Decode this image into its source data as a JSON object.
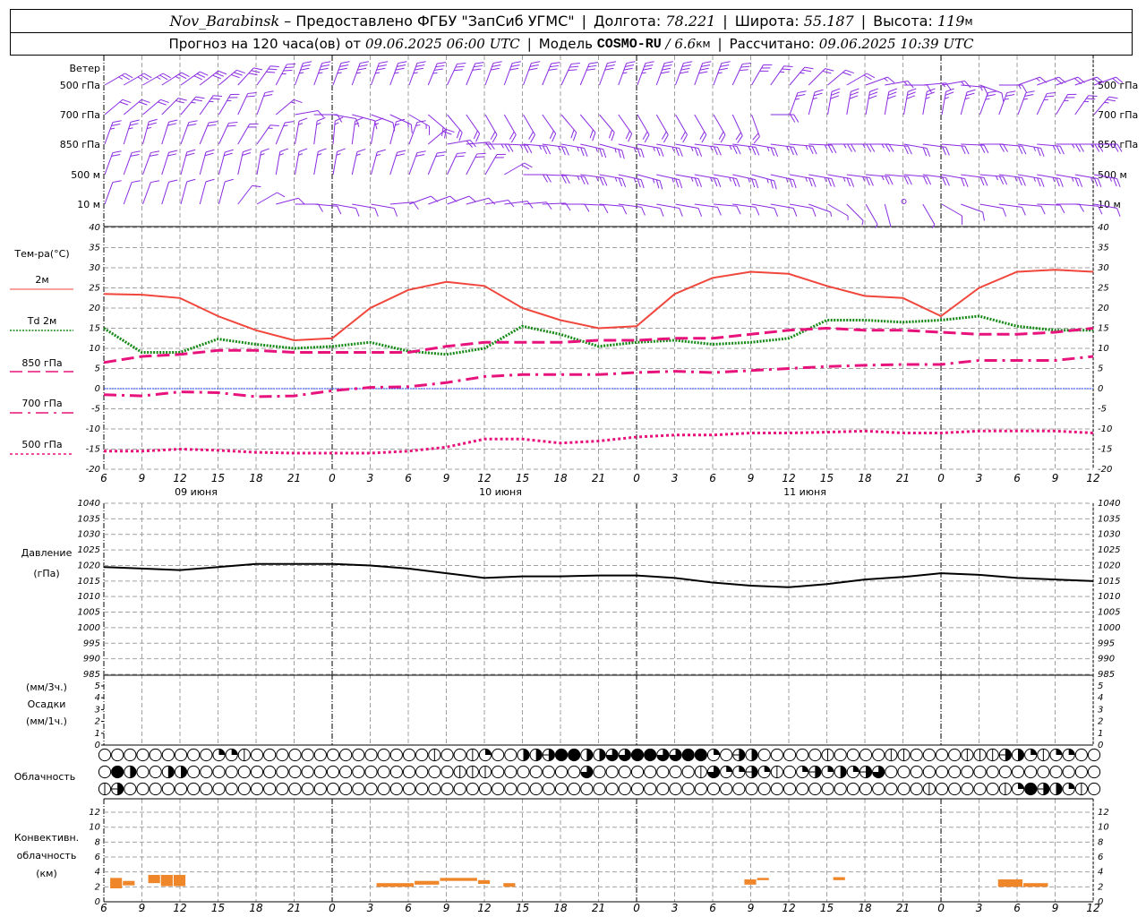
{
  "header": {
    "station": "Nov_Barabinsk",
    "dash": "–",
    "provider": "Предоставлено ФГБУ \"ЗапСиб УГМС\"",
    "lon_label": "Долгота:",
    "lon": "78.221",
    "lat_label": "Широта:",
    "lat": "55.187",
    "alt_label": "Высота:",
    "alt": "119",
    "alt_unit": "м",
    "forecast_label": "Прогноз на 120 часа(ов) от",
    "forecast_start": "09.06.2025 06:00 UTC",
    "model_label": "Модель",
    "model": "COSMO-RU",
    "resolution": "/ 6.6",
    "resolution_unit": "км",
    "computed_label": "Рассчитано:",
    "computed": "09.06.2025 10:39 UTC"
  },
  "labels": {
    "wind": "Ветер",
    "wind_levels": [
      "500 гПа",
      "700 гПа",
      "850 гПа",
      "500 м",
      "10 м"
    ],
    "temp_title": "Тем-ра(°C)",
    "temp_legend": [
      "2м",
      "Td  2м",
      "850 гПа",
      "700 гПа",
      "500 гПа"
    ],
    "pressure_title": "Давление",
    "pressure_unit": "(гПа)",
    "precip_unit3": "(мм/3ч.)",
    "precip_title": "Осадки",
    "precip_unit1": "(мм/1ч.)",
    "cloud_title": "Облачность",
    "conv_title1": "Конвективн.",
    "conv_title2": "облачность",
    "conv_unit": "(км)",
    "dates": [
      "09 июня",
      "10 июня",
      "11 июня"
    ]
  },
  "colors": {
    "t2m": "#f0463c",
    "td2m": "#168a16",
    "t850": "#e8127c",
    "t700": "#e8127c",
    "t500": "#e8127c",
    "zero_line": "#2040ff",
    "wind": "#8a2be2",
    "pressure": "#000000",
    "convective": "#f0862a",
    "grid": "#a0a0a0"
  },
  "chart_data": [
    {
      "type": "line",
      "name": "wind",
      "x_ticks": [
        "6",
        "9",
        "12",
        "15",
        "18",
        "21",
        "0",
        "3",
        "6",
        "9",
        "12",
        "15",
        "18",
        "21",
        "0",
        "3",
        "6",
        "9",
        "12",
        "15",
        "18",
        "21",
        "0",
        "3",
        "6",
        "9",
        "12"
      ],
      "levels": [
        {
          "label": "500 гПа",
          "dir": [
            240,
            240,
            235,
            230,
            215,
            200,
            200,
            200,
            200,
            205,
            200,
            200,
            205,
            200,
            200,
            200,
            200,
            210,
            220,
            230,
            250,
            270,
            260,
            290,
            250,
            250,
            250
          ],
          "speed": [
            12,
            12,
            14,
            15,
            16,
            18,
            18,
            18,
            18,
            16,
            16,
            16,
            14,
            16,
            18,
            20,
            18,
            14,
            12,
            10,
            8,
            6,
            8,
            6,
            8,
            10,
            10
          ]
        },
        {
          "label": "700 гПа",
          "dir": [
            230,
            230,
            220,
            210,
            200,
            260,
            280,
            290,
            300,
            320,
            330,
            330,
            320,
            320,
            330,
            330,
            330,
            340,
            200,
            190,
            190,
            190,
            190,
            200,
            200,
            210,
            220
          ],
          "speed": [
            10,
            10,
            12,
            12,
            10,
            6,
            6,
            6,
            8,
            10,
            10,
            10,
            10,
            10,
            10,
            10,
            10,
            10,
            12,
            14,
            14,
            14,
            12,
            12,
            12,
            12,
            12
          ]
        },
        {
          "label": "850 гПа",
          "dir": [
            200,
            195,
            200,
            205,
            215,
            190,
            185,
            190,
            200,
            260,
            270,
            275,
            280,
            285,
            280,
            280,
            275,
            280,
            275,
            270,
            270,
            280,
            275,
            270,
            280,
            270,
            270
          ],
          "speed": [
            12,
            12,
            10,
            10,
            8,
            8,
            8,
            8,
            8,
            10,
            12,
            12,
            12,
            12,
            12,
            12,
            12,
            12,
            12,
            12,
            12,
            10,
            10,
            10,
            12,
            12,
            12
          ]
        },
        {
          "label": "500 м",
          "dir": [
            200,
            200,
            195,
            195,
            190,
            190,
            190,
            195,
            200,
            205,
            210,
            270,
            275,
            280,
            285,
            280,
            280,
            285,
            280,
            280,
            275,
            275,
            280,
            275,
            280,
            280,
            280
          ],
          "speed": [
            10,
            10,
            10,
            10,
            8,
            8,
            8,
            8,
            10,
            10,
            10,
            10,
            12,
            12,
            12,
            12,
            12,
            12,
            12,
            12,
            12,
            10,
            10,
            12,
            12,
            12,
            12
          ]
        },
        {
          "label": "10 м",
          "dir": [
            200,
            200,
            195,
            195,
            240,
            270,
            280,
            280,
            250,
            250,
            260,
            265,
            270,
            275,
            280,
            280,
            275,
            280,
            280,
            300,
            330,
            0,
            300,
            280,
            275,
            270,
            280
          ],
          "speed": [
            6,
            6,
            6,
            6,
            6,
            4,
            4,
            4,
            6,
            6,
            6,
            6,
            6,
            6,
            6,
            6,
            6,
            4,
            4,
            2,
            2,
            0,
            4,
            6,
            6,
            6,
            6
          ]
        }
      ]
    },
    {
      "type": "line",
      "name": "temperature",
      "x_ticks": [
        "6",
        "9",
        "12",
        "15",
        "18",
        "21",
        "0",
        "3",
        "6",
        "9",
        "12",
        "15",
        "18",
        "21",
        "0",
        "3",
        "6",
        "9",
        "12",
        "15",
        "18",
        "21",
        "0",
        "3",
        "6",
        "9",
        "12"
      ],
      "ylim": [
        -20,
        40
      ],
      "y_ticks": [
        40,
        35,
        30,
        25,
        20,
        15,
        10,
        5,
        0,
        -5,
        -10,
        -15,
        -20
      ],
      "grid": true,
      "series": [
        {
          "name": "2м",
          "values": [
            23.5,
            23.3,
            22.5,
            18,
            14.5,
            12,
            12.5,
            20,
            24.5,
            26.5,
            25.5,
            20,
            17,
            15,
            15.5,
            23.5,
            27.5,
            29,
            28.5,
            25.5,
            23,
            22.5,
            18,
            25,
            29,
            29.5,
            29
          ]
        },
        {
          "name": "Td  2м",
          "values": [
            15,
            9,
            9,
            12.3,
            11,
            10,
            10.5,
            11.5,
            9.3,
            8.5,
            10,
            15.5,
            13.5,
            10.5,
            11.5,
            12,
            11,
            11.5,
            12.5,
            17,
            17,
            16.5,
            17,
            18,
            15.5,
            14.5,
            14.5
          ]
        },
        {
          "name": "850 гПа",
          "values": [
            6.5,
            8,
            8.5,
            9.5,
            9.5,
            9,
            9,
            9,
            9,
            10.5,
            11.5,
            11.5,
            11.5,
            12,
            12,
            12.5,
            12.5,
            13.5,
            14.5,
            15,
            14.5,
            14.5,
            14,
            13.5,
            13.5,
            14,
            15
          ]
        },
        {
          "name": "700 гПа",
          "values": [
            -1.5,
            -1.8,
            -0.8,
            -1,
            -2,
            -1.8,
            -0.5,
            0.3,
            0.5,
            1.5,
            3,
            3.5,
            3.5,
            3.5,
            4,
            4.3,
            4,
            4.5,
            5,
            5.5,
            5.8,
            6,
            6,
            7,
            7,
            7,
            8
          ]
        },
        {
          "name": "500 гПа",
          "values": [
            -15.5,
            -15.5,
            -15,
            -15.3,
            -15.8,
            -16,
            -16,
            -16,
            -15.5,
            -14.5,
            -12.5,
            -12.5,
            -13.5,
            -13,
            -12,
            -11.5,
            -11.5,
            -11,
            -11,
            -10.8,
            -10.5,
            -11,
            -11,
            -10.5,
            -10.5,
            -10.5,
            -11
          ]
        }
      ]
    },
    {
      "type": "line",
      "name": "pressure",
      "ylim": [
        985,
        1040
      ],
      "y_ticks": [
        1040,
        1035,
        1030,
        1025,
        1020,
        1015,
        1010,
        1005,
        1000,
        995,
        990,
        985
      ],
      "grid": true,
      "values": [
        1019.5,
        1019,
        1018.5,
        1019.5,
        1020.5,
        1020.5,
        1020.5,
        1020,
        1019,
        1017.5,
        1016,
        1016.5,
        1016.5,
        1016.8,
        1016.8,
        1016,
        1014.5,
        1013.5,
        1013,
        1014,
        1015.5,
        1016.3,
        1017.5,
        1017,
        1016,
        1015.5,
        1015
      ]
    },
    {
      "type": "bar",
      "name": "precipitation",
      "ylim": [
        0,
        5
      ],
      "y_ticks": [
        5,
        4,
        3,
        2,
        1,
        0
      ],
      "values": []
    },
    {
      "type": "table",
      "name": "cloudiness",
      "rows": [
        [
          "0",
          "0",
          "0",
          "0",
          "0",
          "0",
          "0",
          "0",
          "0",
          "q",
          "q",
          "v",
          "0",
          "0",
          "0",
          "0",
          "0",
          "0",
          "0",
          "0",
          "0",
          "0",
          "0",
          "0",
          "0",
          "0",
          "v",
          "0",
          "0",
          "v",
          "q",
          "0",
          "0",
          "h",
          "h",
          "hl",
          "f",
          "f",
          "h",
          "h",
          "t",
          "t",
          "f",
          "f",
          "t",
          "t",
          "f",
          "f",
          "q",
          "0",
          "hl",
          "h",
          "0",
          "0",
          "0",
          "0",
          "0",
          "v",
          "0",
          "0",
          "0",
          "0",
          "v",
          "v",
          "0",
          "0",
          "0",
          "0",
          "v",
          "v",
          "v",
          "hl",
          "h",
          "q",
          "v",
          "q",
          "q",
          "0",
          "0"
        ],
        [
          "0",
          "f",
          "h",
          "0",
          "0",
          "h",
          "h",
          "0",
          "0",
          "0",
          "0",
          "0",
          "0",
          "0",
          "0",
          "0",
          "0",
          "0",
          "0",
          "0",
          "0",
          "0",
          "0",
          "0",
          "0",
          "0",
          "0",
          "0",
          "v",
          "v",
          "v",
          "0",
          "0",
          "0",
          "0",
          "0",
          "0",
          "0",
          "t",
          "0",
          "0",
          "0",
          "0",
          "0",
          "0",
          "0",
          "0",
          "v",
          "t",
          "q",
          "q",
          "hl",
          "q",
          "v",
          "0",
          "q",
          "hl",
          "q",
          "h",
          "q",
          "hl",
          "t",
          "0",
          "0",
          "0",
          "0",
          "0",
          "0",
          "0",
          "0",
          "0",
          "0",
          "0",
          "0",
          "0",
          "0",
          "0",
          "0",
          "0"
        ],
        [
          "v",
          "hl",
          "0",
          "0",
          "0",
          "0",
          "0",
          "0",
          "0",
          "0",
          "0",
          "0",
          "0",
          "0",
          "0",
          "0",
          "0",
          "0",
          "0",
          "0",
          "0",
          "0",
          "0",
          "0",
          "0",
          "0",
          "0",
          "0",
          "0",
          "0",
          "0",
          "0",
          "0",
          "0",
          "0",
          "0",
          "0",
          "0",
          "0",
          "0",
          "0",
          "0",
          "0",
          "0",
          "0",
          "0",
          "0",
          "0",
          "0",
          "0",
          "0",
          "0",
          "0",
          "0",
          "0",
          "0",
          "0",
          "0",
          "0",
          "0",
          "0",
          "0",
          "0",
          "0",
          "0",
          "v",
          "0",
          "0",
          "0",
          "0",
          "0",
          "v",
          "q",
          "f",
          "hl",
          "h",
          "q",
          "v",
          "0"
        ]
      ]
    },
    {
      "type": "bar",
      "name": "convective",
      "ylim": [
        0,
        14
      ],
      "y_ticks": [
        12,
        10,
        8,
        6,
        4,
        2,
        0
      ],
      "x_ticks": [
        "6",
        "9",
        "12",
        "15",
        "18",
        "21",
        "0",
        "3",
        "6",
        "9",
        "12",
        "15",
        "18",
        "21",
        "0",
        "3",
        "6",
        "9",
        "12",
        "15",
        "18",
        "21",
        "0",
        "3",
        "6",
        "9",
        "12"
      ],
      "bars": [
        {
          "date": "09.06",
          "from": "06:30",
          "to": "07:30",
          "base": 1.8,
          "top": 3.2
        },
        {
          "date": "09.06",
          "from": "07:30",
          "to": "08:30",
          "base": 2.2,
          "top": 2.8
        },
        {
          "date": "09.06",
          "from": "09:30",
          "to": "10:30",
          "base": 2.5,
          "top": 3.6
        },
        {
          "date": "09.06",
          "from": "10:30",
          "to": "11:30",
          "base": 2.1,
          "top": 3.6
        },
        {
          "date": "09.06",
          "from": "11:30",
          "to": "12:30",
          "base": 2.1,
          "top": 3.6
        },
        {
          "date": "10.06",
          "from": "03:30",
          "to": "06:30",
          "base": 2.0,
          "top": 2.5
        },
        {
          "date": "10.06",
          "from": "06:30",
          "to": "08:30",
          "base": 2.3,
          "top": 2.8
        },
        {
          "date": "10.06",
          "from": "08:30",
          "to": "11:30",
          "base": 2.8,
          "top": 3.2
        },
        {
          "date": "10.06",
          "from": "11:30",
          "to": "12:30",
          "base": 2.4,
          "top": 2.9
        },
        {
          "date": "10.06",
          "from": "13:30",
          "to": "14:30",
          "base": 2.0,
          "top": 2.5
        },
        {
          "date": "11.06",
          "from": "08:30",
          "to": "09:30",
          "base": 2.3,
          "top": 3.0
        },
        {
          "date": "11.06",
          "from": "09:30",
          "to": "10:30",
          "base": 2.9,
          "top": 3.2
        },
        {
          "date": "11.06",
          "from": "15:30",
          "to": "16:30",
          "base": 2.9,
          "top": 3.3
        },
        {
          "date": "12.06",
          "from": "04:30",
          "to": "06:30",
          "base": 2.0,
          "top": 3.0
        },
        {
          "date": "12.06",
          "from": "06:30",
          "to": "08:30",
          "base": 2.0,
          "top": 2.5
        }
      ]
    }
  ]
}
